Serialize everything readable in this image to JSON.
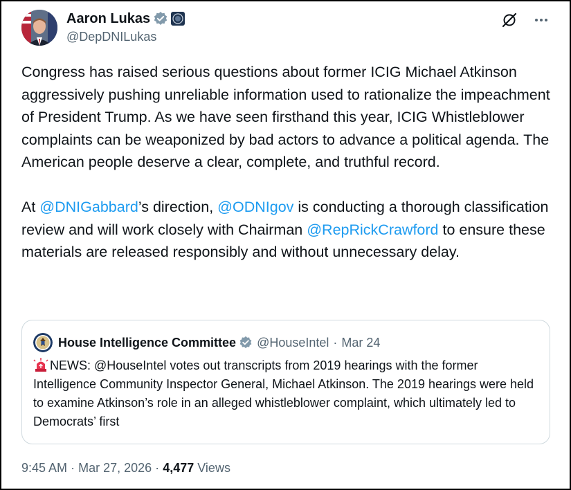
{
  "author": {
    "display_name": "Aaron Lukas",
    "handle": "@DepDNILukas",
    "verified": true
  },
  "actions": {
    "grok_icon": "grok-icon",
    "more_icon": "more-icon"
  },
  "tweet": {
    "paragraph1": "Congress has raised serious questions about former ICIG Michael Atkinson aggressively pushing unreliable information used to rationalize the impeachment of President Trump. As we have seen firsthand this year, ICIG Whistleblower complaints can be weaponized by bad actors to advance a political agenda. The American people deserve a clear, complete, and truthful record.",
    "p2_prefix": "At ",
    "mention1": "@DNIGabbard",
    "p2_part2": "’s direction, ",
    "mention2": "@ODNIgov",
    "p2_part3": " is conducting a thorough classification review and will work closely with Chairman ",
    "mention3": "@RepRickCrawford",
    "p2_part4": " to ensure these materials are released responsibly and without unnecessary delay."
  },
  "quote": {
    "display_name": "House Intelligence Committee",
    "handle": "@HouseIntel",
    "separator": "·",
    "date": "Mar 24",
    "text": "NEWS: @HouseIntel votes out transcripts from 2019 hearings with the former Intelligence Community Inspector General, Michael Atkinson. The 2019 hearings were held to examine Atkinson’s role in an alleged whistleblower complaint, which ultimately led to Democrats’ first"
  },
  "footer": {
    "time": "9:45 AM",
    "sep1": "·",
    "date": "Mar 27, 2026",
    "sep2": "·",
    "views_count": "4,477",
    "views_label": "Views"
  },
  "colors": {
    "link": "#1d9bf0",
    "secondary_text": "#536471",
    "primary_text": "#0f1419",
    "border": "#cfd9de",
    "verified_gray": "#829aab"
  }
}
